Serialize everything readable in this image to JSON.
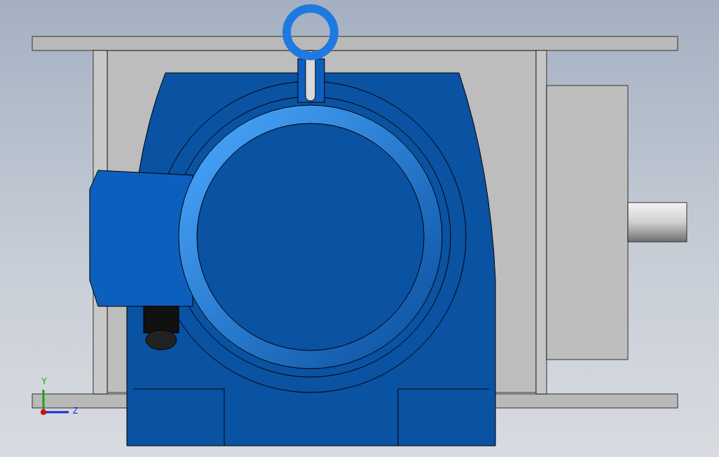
{
  "viewport": {
    "triad": {
      "axes": [
        {
          "label": "Y"
        },
        {
          "label": "Z"
        }
      ]
    }
  }
}
